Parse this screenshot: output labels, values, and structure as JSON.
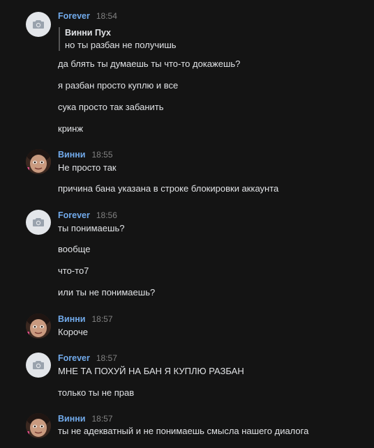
{
  "colors": {
    "background": "#141414",
    "author_link": "#71aaeb",
    "text": "#e1e3e6",
    "time": "#828282"
  },
  "messages": [
    {
      "author": "Forever",
      "time": "18:54",
      "avatar": "camera-icon",
      "quote": {
        "author": "Винни Пух",
        "text": "но ты разбан не получишь"
      },
      "lines": [
        "да блять ты думаешь ты что-то докажешь?",
        "я разбан просто куплю и все",
        "сука просто так забанить",
        "кринж"
      ]
    },
    {
      "author": "Винни",
      "time": "18:55",
      "avatar": "user-photo",
      "lines": [
        "Не просто так",
        "причина бана указана в строке блокировки аккаунта"
      ]
    },
    {
      "author": "Forever",
      "time": "18:56",
      "avatar": "camera-icon",
      "lines": [
        "ты понимаешь?",
        "вообще",
        "что-то7",
        "или ты не понимаешь?"
      ]
    },
    {
      "author": "Винни",
      "time": "18:57",
      "avatar": "user-photo",
      "lines": [
        "Короче"
      ]
    },
    {
      "author": "Forever",
      "time": "18:57",
      "avatar": "camera-icon",
      "lines": [
        "МНЕ ТА ПОХУЙ НА БАН Я КУПЛЮ РАЗБАН",
        "только ты не прав"
      ]
    },
    {
      "author": "Винни",
      "time": "18:57",
      "avatar": "user-photo",
      "lines": [
        "ты не адекватный и не понимаешь смысла нашего диалога"
      ]
    }
  ]
}
